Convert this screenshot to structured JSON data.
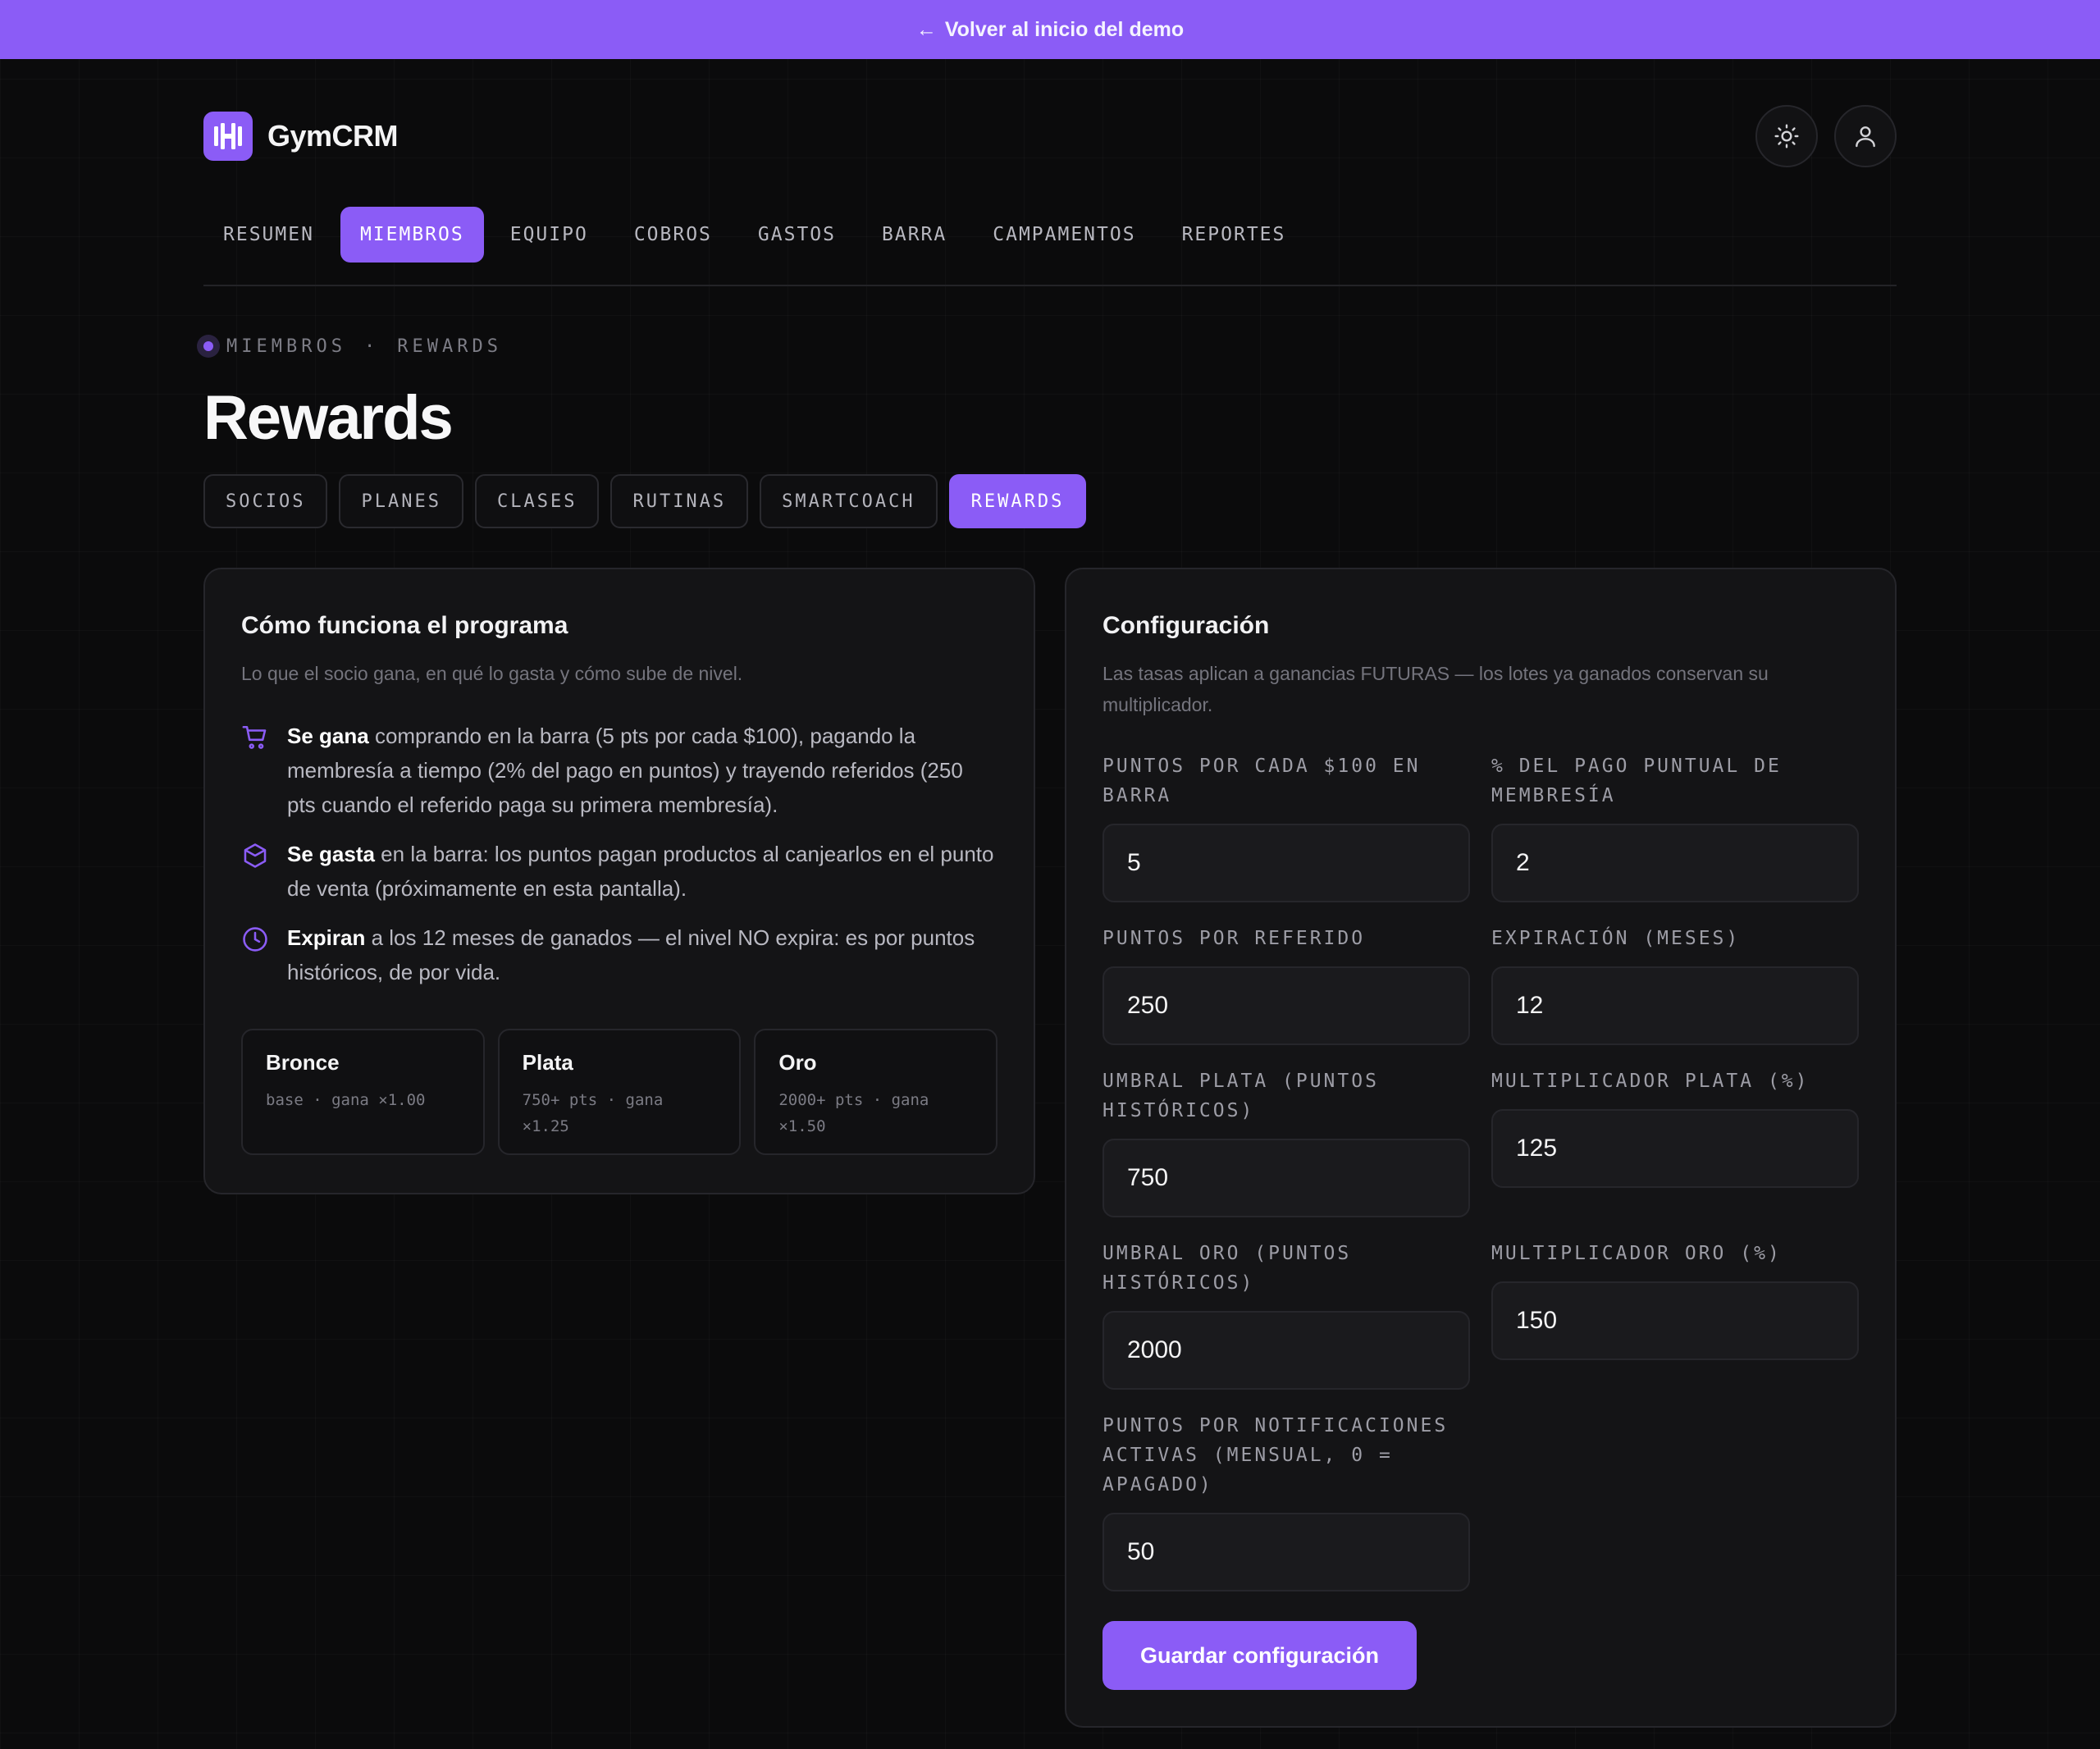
{
  "banner": {
    "arrow": "←",
    "text": "Volver al inicio del demo"
  },
  "header": {
    "brand": "GymCRM"
  },
  "nav": [
    "RESUMEN",
    "MIEMBROS",
    "EQUIPO",
    "COBROS",
    "GASTOS",
    "BARRA",
    "CAMPAMENTOS",
    "REPORTES"
  ],
  "nav_active": "MIEMBROS",
  "breadcrumb": {
    "section": "MIEMBROS",
    "sep": "·",
    "page": "REWARDS"
  },
  "page_title": "Rewards",
  "sub_tabs": [
    "SOCIOS",
    "PLANES",
    "CLASES",
    "RUTINAS",
    "SMARTCOACH",
    "REWARDS"
  ],
  "sub_tab_active": "REWARDS",
  "program": {
    "title": "Cómo funciona el programa",
    "subtitle": "Lo que el socio gana, en qué lo gasta y cómo sube de nivel.",
    "rules": [
      {
        "icon": "cart-icon",
        "bold": "Se gana",
        "text": " comprando en la barra (5 pts por cada $100), pagando la membresía a tiempo (2% del pago en puntos) y trayendo referidos (250 pts cuando el referido paga su primera membresía)."
      },
      {
        "icon": "box-icon",
        "bold": "Se gasta",
        "text": " en la barra: los puntos pagan productos al canjearlos en el punto de venta (próximamente en esta pantalla)."
      },
      {
        "icon": "clock-icon",
        "bold": "Expiran",
        "text": " a los 12 meses de ganados — el nivel NO expira: es por puntos históricos, de por vida."
      }
    ],
    "tiers": [
      {
        "name": "Bronce",
        "desc": "base · gana ×1.00"
      },
      {
        "name": "Plata",
        "desc": "750+ pts · gana ×1.25"
      },
      {
        "name": "Oro",
        "desc": "2000+ pts · gana ×1.50"
      }
    ]
  },
  "config": {
    "title": "Configuración",
    "subtitle": "Las tasas aplican a ganancias FUTURAS — los lotes ya ganados conservan su multiplicador.",
    "fields": {
      "bar_points": {
        "label": "PUNTOS POR CADA $100 EN BARRA",
        "value": "5"
      },
      "membership_pct": {
        "label": "% DEL PAGO PUNTUAL DE MEMBRESÍA",
        "value": "2"
      },
      "referral_points": {
        "label": "PUNTOS POR REFERIDO",
        "value": "250"
      },
      "expiration": {
        "label": "EXPIRACIÓN (MESES)",
        "value": "12"
      },
      "silver_threshold": {
        "label": "UMBRAL PLATA (PUNTOS HISTÓRICOS)",
        "value": "750"
      },
      "silver_mult": {
        "label": "MULTIPLICADOR PLATA (%)",
        "value": "125"
      },
      "gold_threshold": {
        "label": "UMBRAL ORO (PUNTOS HISTÓRICOS)",
        "value": "2000"
      },
      "gold_mult": {
        "label": "MULTIPLICADOR ORO (%)",
        "value": "150"
      },
      "notif_points": {
        "label": "PUNTOS POR NOTIFICACIONES ACTIVAS (MENSUAL, 0 = APAGADO)",
        "value": "50"
      }
    },
    "save_label": "Guardar configuración"
  },
  "colors": {
    "accent": "#8b5cf6",
    "background": "#0b0b0c",
    "card": "#141416"
  }
}
